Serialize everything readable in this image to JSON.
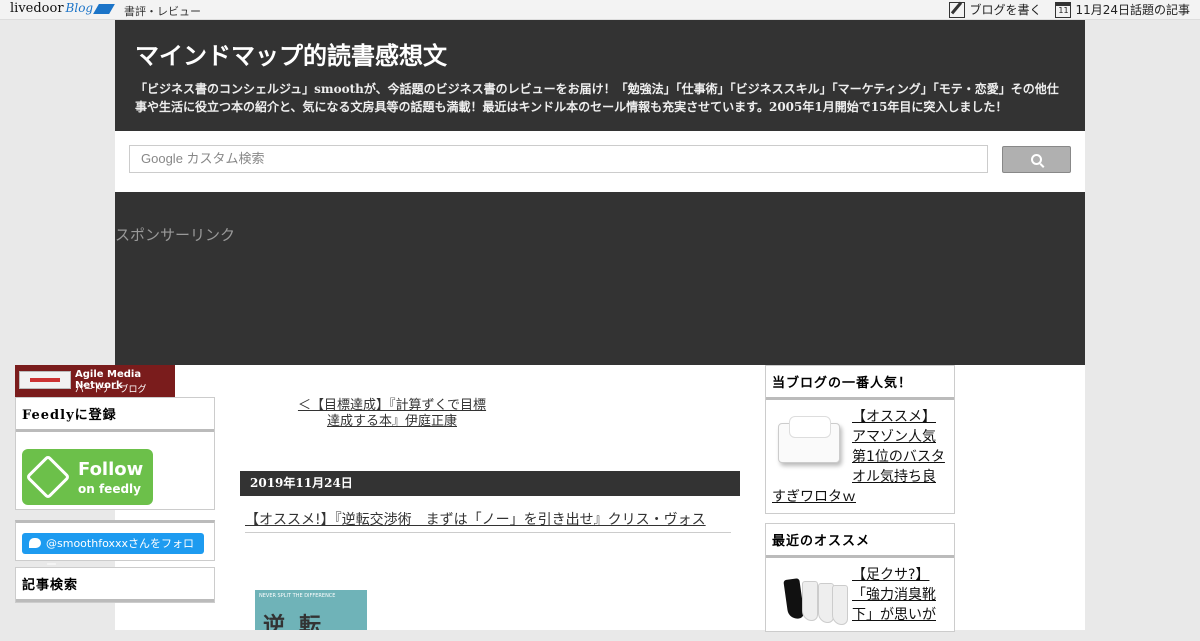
{
  "topbar": {
    "logo_text": "livedoor",
    "logo_blog": "Blog",
    "category": "書評・レビュー",
    "write_label": "ブログを書く",
    "calendar_day": "11",
    "date_topic": "11月24日話題の記事"
  },
  "header": {
    "title": "マインドマップ的読書感想文",
    "description": "「ビジネス書のコンシェルジュ」smoothが、今話題のビジネス書のレビューをお届け！「勉強法」「仕事術」「ビジネススキル」「マーケティング」「モテ・恋愛」その他仕事や生活に役立つ本の紹介と、気になる文房具等の話題も満載！最近はキンドル本のセール情報も充実させています。2005年1月開始で15年目に突入しました！"
  },
  "search": {
    "placeholder": "Google カスタム検索"
  },
  "sponsor": {
    "label": "スポンサーリンク"
  },
  "left_sidebar": {
    "amn_title": "Agile Media Network",
    "amn_sub": "パートナーブログ",
    "feedly_title": "Feedlyに登録",
    "feedly_follow": "Follow",
    "feedly_on": "on feedly",
    "twitter_label": "@smoothfoxxxさんをフォロー",
    "search_title": "記事検索"
  },
  "main": {
    "prev_link": "＜【目標達成】『計算ずくで目標達成する本』伊庭正康",
    "date": "2019年11月24日",
    "post_title": "【オススメ!】『逆転交渉術　まずは「ノー」を引き出せ』クリス・ヴォス",
    "book_header": "NEVER SPLIT THE DIFFERENCE",
    "book_title": "逆転"
  },
  "right_sidebar": {
    "popular_title": "当ブログの一番人気！",
    "popular_post": "【オススメ】アマゾン人気第1位のバスタオル気持ち良すぎワロタｗ",
    "recent_title": "最近のオススメ",
    "recent_post": "【足クサ?】「強力消臭靴下」が思いが"
  }
}
